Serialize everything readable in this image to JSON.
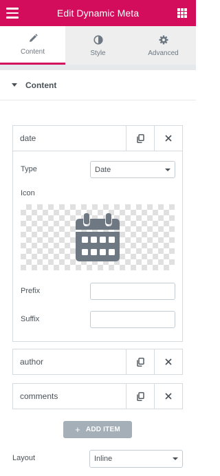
{
  "header": {
    "title": "Edit Dynamic Meta",
    "menu_icon": "hamburger-icon",
    "apps_icon": "grid-icon",
    "background": "#d30c5c"
  },
  "tabs": [
    {
      "label": "Content",
      "icon": "pencil-icon",
      "active": true
    },
    {
      "label": "Style",
      "icon": "half-circle-icon",
      "active": false
    },
    {
      "label": "Advanced",
      "icon": "gear-icon",
      "active": false
    }
  ],
  "section": {
    "title": "Content",
    "expanded": true
  },
  "repeater": {
    "items": [
      {
        "title": "date",
        "expanded": true,
        "fields": {
          "type_label": "Type",
          "type_value": "Date",
          "icon_label": "Icon",
          "icon_value": "calendar-icon",
          "prefix_label": "Prefix",
          "prefix_value": "",
          "suffix_label": "Suffix",
          "suffix_value": ""
        }
      },
      {
        "title": "author",
        "expanded": false
      },
      {
        "title": "comments",
        "expanded": false
      }
    ],
    "duplicate_icon": "copy-icon",
    "remove_icon": "close-icon",
    "add_label": "ADD ITEM"
  },
  "layout": {
    "label": "Layout",
    "value": "Inline"
  }
}
